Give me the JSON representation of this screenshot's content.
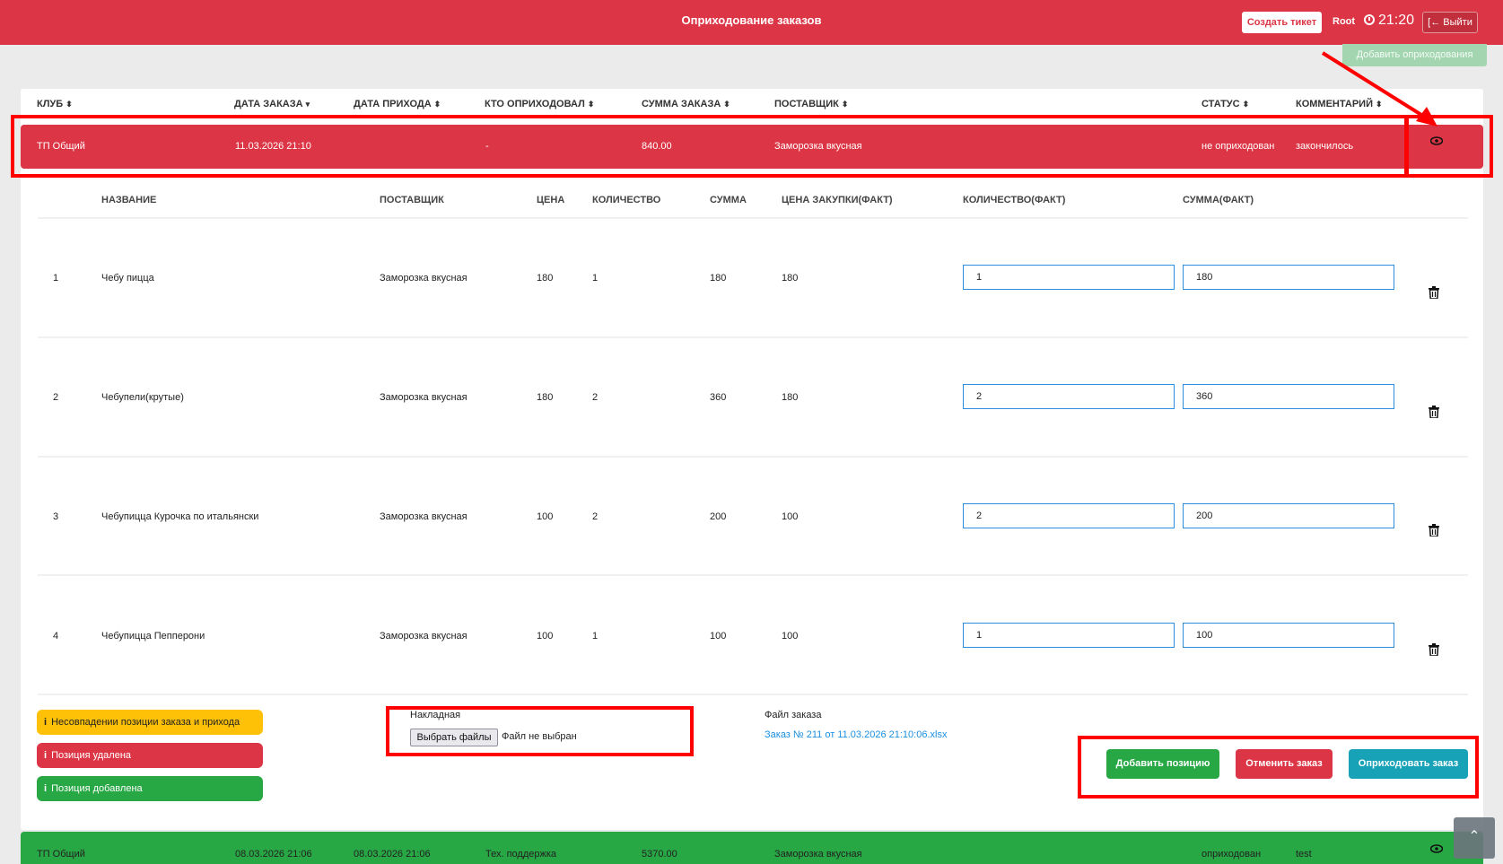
{
  "header": {
    "title": "Оприходование заказов",
    "ticket_button": "Создать тикет",
    "user": "Root",
    "time": "21:20",
    "logout": "Выйти"
  },
  "add_receipt_button": "Добавить оприходования",
  "table": {
    "columns": [
      "КЛУБ",
      "ДАТА ЗАКАЗА",
      "ДАТА ПРИХОДА",
      "КТО ОПРИХОДОВАЛ",
      "СУММА ЗАКАЗА",
      "ПОСТАВЩИК",
      "СТАТУС",
      "КОММЕНТАРИЙ"
    ],
    "orders": [
      {
        "club": "ТП Общий",
        "order_date": "11.03.2026 21:10",
        "arrival_date": "",
        "received_by": "-",
        "sum": "840.00",
        "supplier": "Заморозка вкусная",
        "status": "не оприходован",
        "comment": "закончилось"
      },
      {
        "club": "ТП Общий",
        "order_date": "08.03.2026 21:06",
        "arrival_date": "08.03.2026 21:06",
        "received_by": "Тех. поддержка",
        "sum": "5370.00",
        "supplier": "Заморозка вкусная",
        "status": "оприходован",
        "comment": "test"
      }
    ]
  },
  "items": {
    "columns": [
      "НАЗВАНИЕ",
      "ПОСТАВЩИК",
      "ЦЕНА",
      "КОЛИЧЕСТВО",
      "СУММА",
      "ЦЕНА ЗАКУПКИ(ФАКТ)",
      "КОЛИЧЕСТВО(ФАКТ)",
      "СУММА(ФАКТ)"
    ],
    "rows": [
      {
        "num": "1",
        "name": "Чебу пицца",
        "supplier": "Заморозка вкусная",
        "price": "180",
        "qty": "1",
        "sum": "180",
        "purchase_price": "180",
        "qty_fact": "1",
        "sum_fact": "180"
      },
      {
        "num": "2",
        "name": "Чебупели(крутые)",
        "supplier": "Заморозка вкусная",
        "price": "180",
        "qty": "2",
        "sum": "360",
        "purchase_price": "180",
        "qty_fact": "2",
        "sum_fact": "360"
      },
      {
        "num": "3",
        "name": "Чебупицца Курочка по итальянски",
        "supplier": "Заморозка вкусная",
        "price": "100",
        "qty": "2",
        "sum": "200",
        "purchase_price": "100",
        "qty_fact": "2",
        "sum_fact": "200"
      },
      {
        "num": "4",
        "name": "Чебупицца Пепперони",
        "supplier": "Заморозка вкусная",
        "price": "100",
        "qty": "1",
        "sum": "100",
        "purchase_price": "100",
        "qty_fact": "1",
        "sum_fact": "100"
      }
    ]
  },
  "legend": {
    "mismatch": "Несовпадении позиции заказа и прихода",
    "deleted": "Позиция удалена",
    "added": "Позиция добавлена"
  },
  "invoice": {
    "label": "Накладная",
    "choose_files": "Выбрать файлы",
    "no_file": "Файл не выбран"
  },
  "order_file": {
    "label": "Файл заказа",
    "link": "Заказ № 211 от 11.03.2026 21:10:06.xlsx"
  },
  "actions": {
    "add_position": "Добавить позицию",
    "cancel_order": "Отменить заказ",
    "receive_order": "Оприходовать заказ"
  },
  "colors": {
    "danger": "#dc3545",
    "success": "#28a745",
    "warning": "#ffc107",
    "info": "#17a2b8",
    "annotation": "#ff0000"
  },
  "icons": [
    "eye-icon",
    "trash-icon",
    "clock-icon",
    "logout-icon",
    "info-icon",
    "chevron-up-icon",
    "sort-icon"
  ]
}
